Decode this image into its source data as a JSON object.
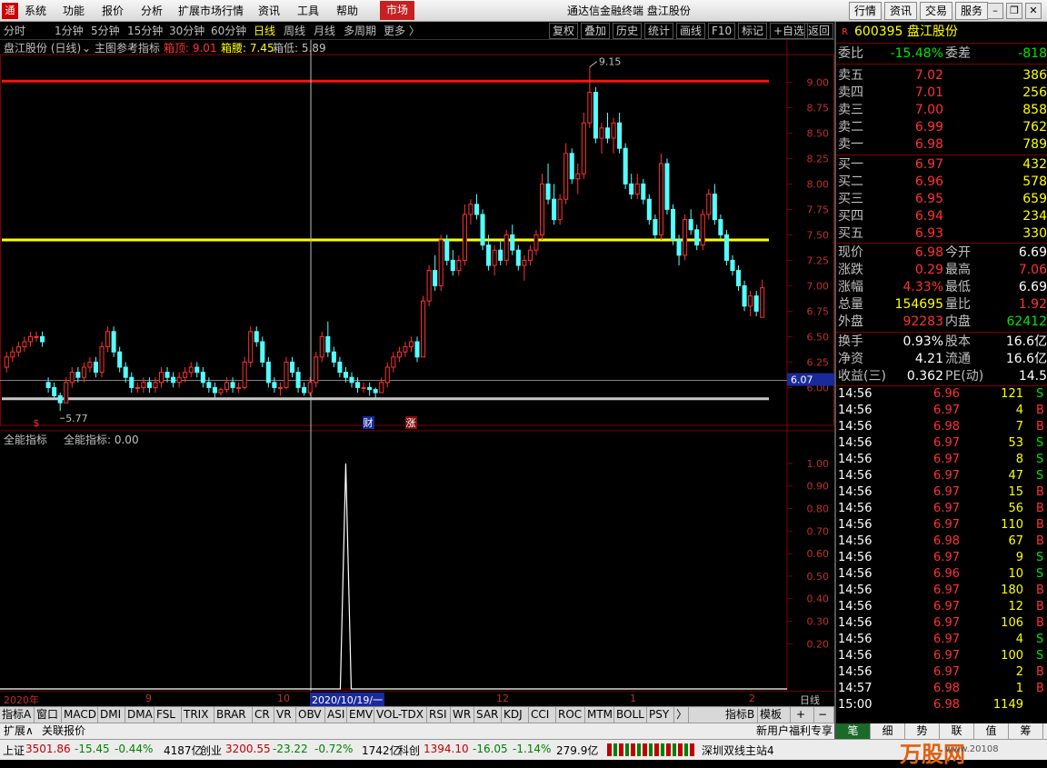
{
  "menubar": {
    "items": [
      "系统",
      "功能",
      "报价",
      "分析",
      "扩展市场行情",
      "资讯",
      "工具",
      "帮助"
    ],
    "market_button": "市场",
    "window_title": "通达信金融终端  盘江股份",
    "right_buttons": [
      "行情",
      "资讯",
      "交易",
      "服务"
    ]
  },
  "periods": {
    "items": [
      "分时",
      "1分钟",
      "5分钟",
      "15分钟",
      "30分钟",
      "60分钟",
      "日线",
      "周线",
      "月线",
      "多周期",
      "更多 〉"
    ],
    "active": "日线",
    "tools": [
      "复权",
      "叠加",
      "历史",
      "统计",
      "画线",
      "F10",
      "标记",
      "+自选",
      "返回"
    ]
  },
  "main_chart": {
    "stock_label": "盘江股份 (日线)",
    "indicator": "主图参考指标",
    "box_top_label": "箱顶: 9.01",
    "box_mid_label": "箱腰: 7.45",
    "box_bottom_label": "箱低: 5.89",
    "max_label": "9.15",
    "min_label": "5.77",
    "y_ticks": [
      "9.00",
      "8.75",
      "8.50",
      "8.25",
      "8.00",
      "7.75",
      "7.50",
      "7.25",
      "7.00",
      "6.75",
      "6.50",
      "6.25",
      "6.00"
    ],
    "current_price_tag": "6.07",
    "markers": [
      "$",
      "财",
      "涨"
    ]
  },
  "sub_chart": {
    "label": "全能指标",
    "value_label": "全能指标: 0.00",
    "y_ticks": [
      "1.00",
      "0.90",
      "0.80",
      "0.70",
      "0.60",
      "0.50",
      "0.40",
      "0.30",
      "0.20"
    ]
  },
  "x_axis": {
    "labels": [
      "2020年",
      "9",
      "10",
      "2020/10/19/一",
      "12",
      "1",
      "2"
    ],
    "right_label": "日线"
  },
  "indicators": {
    "items": [
      "指标A",
      "窗口",
      "MACD",
      "DMI",
      "DMA",
      "FSL",
      "TRIX",
      "BRAR",
      "CR",
      "VR",
      "OBV",
      "ASI",
      "EMV",
      "VOL-TDX",
      "RSI",
      "WR",
      "SAR",
      "KDJ",
      "CCI",
      "ROC",
      "MTM",
      "BOLL",
      "PSY",
      "〉"
    ],
    "right": [
      "指标B",
      "模板",
      "+",
      "−"
    ]
  },
  "ext_bar": {
    "items": [
      "扩展∧",
      "关联报价"
    ],
    "right": "新用户福利专享"
  },
  "statusbar": {
    "sh": {
      "name": "上证",
      "value": "3501.86",
      "chg": "-15.45",
      "pct": "-0.44%",
      "amt": "4187亿"
    },
    "cy": {
      "name": "创业",
      "value": "3200.55",
      "chg": "-23.22",
      "pct": "-0.72%",
      "amt": "1742亿"
    },
    "kc": {
      "name": "科创",
      "value": "1394.10",
      "chg": "-16.05",
      "pct": "-1.14%",
      "amt": "279.9亿"
    },
    "server": "深圳双线主站4",
    "watermark": "万股网",
    "watermark_url": "www.20108"
  },
  "quote": {
    "code": "600395",
    "name": "盘江股份",
    "badge": "R",
    "wb_label": "委比",
    "wb": "-15.48%",
    "wc_label": "委差",
    "wc": "-818",
    "asks": [
      {
        "label": "卖五",
        "price": "7.02",
        "vol": "386"
      },
      {
        "label": "卖四",
        "price": "7.01",
        "vol": "256"
      },
      {
        "label": "卖三",
        "price": "7.00",
        "vol": "858"
      },
      {
        "label": "卖二",
        "price": "6.99",
        "vol": "762"
      },
      {
        "label": "卖一",
        "price": "6.98",
        "vol": "789"
      }
    ],
    "bids": [
      {
        "label": "买一",
        "price": "6.97",
        "vol": "432"
      },
      {
        "label": "买二",
        "price": "6.96",
        "vol": "578"
      },
      {
        "label": "买三",
        "price": "6.95",
        "vol": "659"
      },
      {
        "label": "买四",
        "price": "6.94",
        "vol": "234"
      },
      {
        "label": "买五",
        "price": "6.93",
        "vol": "330"
      }
    ],
    "stats": [
      {
        "l1": "现价",
        "v1": "6.98",
        "c1": "red",
        "l2": "今开",
        "v2": "6.69",
        "c2": "white"
      },
      {
        "l1": "涨跌",
        "v1": "0.29",
        "c1": "red",
        "l2": "最高",
        "v2": "7.06",
        "c2": "red"
      },
      {
        "l1": "涨幅",
        "v1": "4.33%",
        "c1": "red",
        "l2": "最低",
        "v2": "6.69",
        "c2": "white"
      },
      {
        "l1": "总量",
        "v1": "154695",
        "c1": "yellow",
        "l2": "量比",
        "v2": "1.92",
        "c2": "red"
      },
      {
        "l1": "外盘",
        "v1": "92283",
        "c1": "red",
        "l2": "内盘",
        "v2": "62412",
        "c2": "green"
      }
    ],
    "stats2": [
      {
        "l1": "换手",
        "v1": "0.93%",
        "l2": "股本",
        "v2": "16.6亿"
      },
      {
        "l1": "净资",
        "v1": "4.21",
        "l2": "流通",
        "v2": "16.6亿"
      },
      {
        "l1": "收益(三)",
        "v1": "0.362",
        "l2": "PE(动)",
        "v2": "14.5"
      }
    ],
    "ticks": [
      {
        "t": "14:56",
        "p": "6.96",
        "q": "121",
        "s": "S"
      },
      {
        "t": "14:56",
        "p": "6.97",
        "q": "4",
        "s": "B"
      },
      {
        "t": "14:56",
        "p": "6.98",
        "q": "7",
        "s": "B"
      },
      {
        "t": "14:56",
        "p": "6.97",
        "q": "53",
        "s": "S"
      },
      {
        "t": "14:56",
        "p": "6.97",
        "q": "8",
        "s": "S"
      },
      {
        "t": "14:56",
        "p": "6.97",
        "q": "47",
        "s": "S"
      },
      {
        "t": "14:56",
        "p": "6.97",
        "q": "15",
        "s": "B"
      },
      {
        "t": "14:56",
        "p": "6.97",
        "q": "56",
        "s": "B"
      },
      {
        "t": "14:56",
        "p": "6.97",
        "q": "110",
        "s": "B"
      },
      {
        "t": "14:56",
        "p": "6.98",
        "q": "67",
        "s": "B"
      },
      {
        "t": "14:56",
        "p": "6.97",
        "q": "9",
        "s": "S"
      },
      {
        "t": "14:56",
        "p": "6.96",
        "q": "10",
        "s": "S"
      },
      {
        "t": "14:56",
        "p": "6.97",
        "q": "180",
        "s": "B"
      },
      {
        "t": "14:56",
        "p": "6.97",
        "q": "12",
        "s": "B"
      },
      {
        "t": "14:56",
        "p": "6.97",
        "q": "106",
        "s": "B"
      },
      {
        "t": "14:56",
        "p": "6.97",
        "q": "4",
        "s": "S"
      },
      {
        "t": "14:56",
        "p": "6.97",
        "q": "100",
        "s": "S"
      },
      {
        "t": "14:56",
        "p": "6.97",
        "q": "2",
        "s": "B"
      },
      {
        "t": "14:57",
        "p": "6.98",
        "q": "1",
        "s": "B"
      },
      {
        "t": "15:00",
        "p": "6.98",
        "q": "1149",
        "s": ""
      }
    ],
    "bottom_tabs": [
      "笔",
      "细",
      "势",
      "联",
      "值",
      "筹"
    ]
  },
  "chart_data": {
    "type": "candlestick",
    "y_ticks": [
      9.0,
      8.75,
      8.5,
      8.25,
      8.0,
      7.75,
      7.5,
      7.25,
      7.0,
      6.75,
      6.5,
      6.25,
      6.0
    ],
    "ylim": [
      5.7,
      9.2
    ],
    "box_top": 9.01,
    "box_mid": 7.45,
    "box_bottom": 5.89,
    "candles": [
      [
        6.2,
        6.35,
        6.15,
        6.3
      ],
      [
        6.3,
        6.4,
        6.25,
        6.35
      ],
      [
        6.35,
        6.45,
        6.3,
        6.4
      ],
      [
        6.4,
        6.5,
        6.35,
        6.45
      ],
      [
        6.45,
        6.55,
        6.4,
        6.5
      ],
      [
        6.5,
        6.55,
        6.45,
        6.5
      ],
      [
        6.5,
        6.55,
        6.4,
        6.45
      ],
      [
        6.05,
        6.1,
        5.95,
        6.0
      ],
      [
        6.0,
        6.05,
        5.9,
        5.92
      ],
      [
        5.92,
        5.95,
        5.77,
        5.85
      ],
      [
        5.85,
        6.1,
        5.85,
        6.05
      ],
      [
        6.05,
        6.2,
        6.0,
        6.15
      ],
      [
        6.15,
        6.2,
        6.05,
        6.1
      ],
      [
        6.1,
        6.25,
        6.05,
        6.2
      ],
      [
        6.2,
        6.3,
        6.15,
        6.25
      ],
      [
        6.25,
        6.3,
        6.1,
        6.15
      ],
      [
        6.15,
        6.45,
        6.1,
        6.4
      ],
      [
        6.4,
        6.6,
        6.35,
        6.55
      ],
      [
        6.55,
        6.6,
        6.3,
        6.35
      ],
      [
        6.35,
        6.4,
        6.15,
        6.2
      ],
      [
        6.2,
        6.25,
        6.05,
        6.1
      ],
      [
        6.1,
        6.15,
        5.95,
        6.0
      ],
      [
        6.0,
        6.05,
        5.95,
        6.0
      ],
      [
        6.0,
        6.1,
        5.95,
        6.05
      ],
      [
        6.05,
        6.1,
        5.95,
        6.0
      ],
      [
        6.0,
        6.1,
        5.95,
        6.05
      ],
      [
        6.05,
        6.2,
        6.0,
        6.15
      ],
      [
        6.15,
        6.2,
        6.05,
        6.1
      ],
      [
        6.1,
        6.15,
        6.0,
        6.05
      ],
      [
        6.05,
        6.15,
        6.0,
        6.1
      ],
      [
        6.1,
        6.2,
        6.05,
        6.15
      ],
      [
        6.15,
        6.25,
        6.1,
        6.2
      ],
      [
        6.2,
        6.25,
        6.1,
        6.15
      ],
      [
        6.15,
        6.2,
        6.0,
        6.05
      ],
      [
        6.05,
        6.1,
        5.95,
        6.0
      ],
      [
        6.0,
        6.05,
        5.9,
        5.95
      ],
      [
        5.95,
        6.0,
        5.92,
        5.98
      ],
      [
        5.98,
        6.1,
        5.95,
        6.05
      ],
      [
        6.05,
        6.1,
        5.95,
        6.0
      ],
      [
        6.0,
        6.05,
        5.95,
        6.0
      ],
      [
        6.0,
        6.3,
        5.98,
        6.25
      ],
      [
        6.25,
        6.6,
        6.2,
        6.55
      ],
      [
        6.55,
        6.6,
        6.4,
        6.45
      ],
      [
        6.45,
        6.5,
        6.2,
        6.25
      ],
      [
        6.25,
        6.3,
        6.0,
        6.05
      ],
      [
        6.05,
        6.1,
        5.95,
        6.0
      ],
      [
        6.0,
        6.05,
        5.92,
        6.0
      ],
      [
        6.0,
        6.3,
        5.98,
        6.25
      ],
      [
        6.25,
        6.3,
        6.1,
        6.15
      ],
      [
        6.15,
        6.2,
        5.95,
        6.0
      ],
      [
        6.0,
        6.05,
        5.92,
        5.95
      ],
      [
        5.95,
        6.1,
        5.92,
        6.05
      ],
      [
        6.05,
        6.35,
        6.0,
        6.3
      ],
      [
        6.3,
        6.55,
        6.25,
        6.5
      ],
      [
        6.5,
        6.65,
        6.3,
        6.35
      ],
      [
        6.35,
        6.4,
        6.2,
        6.25
      ],
      [
        6.25,
        6.3,
        6.1,
        6.15
      ],
      [
        6.15,
        6.2,
        6.05,
        6.1
      ],
      [
        6.1,
        6.15,
        6.0,
        6.05
      ],
      [
        6.05,
        6.1,
        5.95,
        6.0
      ],
      [
        6.0,
        6.05,
        5.95,
        6.0
      ],
      [
        6.0,
        6.05,
        5.92,
        5.98
      ],
      [
        5.98,
        6.0,
        5.9,
        5.95
      ],
      [
        5.95,
        6.1,
        5.95,
        6.05
      ],
      [
        6.05,
        6.25,
        6.0,
        6.2
      ],
      [
        6.2,
        6.35,
        6.15,
        6.3
      ],
      [
        6.3,
        6.4,
        6.25,
        6.35
      ],
      [
        6.35,
        6.45,
        6.3,
        6.4
      ],
      [
        6.4,
        6.5,
        6.35,
        6.45
      ],
      [
        6.45,
        6.5,
        6.25,
        6.3
      ],
      [
        6.3,
        6.9,
        6.3,
        6.85
      ],
      [
        6.85,
        7.2,
        6.8,
        7.15
      ],
      [
        7.15,
        7.3,
        6.95,
        7.0
      ],
      [
        7.0,
        7.5,
        6.95,
        7.45
      ],
      [
        7.45,
        7.5,
        7.2,
        7.25
      ],
      [
        7.25,
        7.35,
        7.1,
        7.15
      ],
      [
        7.15,
        7.3,
        7.1,
        7.25
      ],
      [
        7.25,
        7.8,
        7.2,
        7.7
      ],
      [
        7.7,
        7.85,
        7.6,
        7.8
      ],
      [
        7.8,
        7.9,
        7.65,
        7.7
      ],
      [
        7.7,
        7.75,
        7.35,
        7.4
      ],
      [
        7.4,
        7.5,
        7.15,
        7.2
      ],
      [
        7.2,
        7.4,
        7.1,
        7.35
      ],
      [
        7.35,
        7.45,
        7.2,
        7.25
      ],
      [
        7.25,
        7.55,
        7.2,
        7.5
      ],
      [
        7.5,
        7.6,
        7.3,
        7.35
      ],
      [
        7.35,
        7.4,
        7.15,
        7.2
      ],
      [
        7.2,
        7.3,
        7.05,
        7.25
      ],
      [
        7.25,
        7.4,
        7.2,
        7.35
      ],
      [
        7.35,
        7.55,
        7.3,
        7.5
      ],
      [
        7.5,
        8.1,
        7.45,
        8.0
      ],
      [
        8.0,
        8.2,
        7.8,
        7.85
      ],
      [
        7.85,
        8.0,
        7.6,
        7.65
      ],
      [
        7.65,
        7.9,
        7.6,
        7.85
      ],
      [
        7.85,
        8.4,
        7.8,
        8.3
      ],
      [
        8.3,
        8.35,
        8.0,
        8.05
      ],
      [
        8.05,
        8.2,
        7.9,
        8.1
      ],
      [
        8.1,
        8.7,
        8.05,
        8.6
      ],
      [
        8.6,
        9.15,
        8.55,
        8.9
      ],
      [
        8.9,
        8.95,
        8.4,
        8.45
      ],
      [
        8.45,
        8.6,
        8.3,
        8.55
      ],
      [
        8.55,
        8.7,
        8.4,
        8.45
      ],
      [
        8.45,
        8.65,
        8.3,
        8.6
      ],
      [
        8.6,
        8.7,
        8.3,
        8.35
      ],
      [
        8.35,
        8.4,
        7.95,
        8.0
      ],
      [
        8.0,
        8.1,
        7.85,
        7.9
      ],
      [
        7.9,
        8.1,
        7.85,
        8.0
      ],
      [
        8.0,
        8.05,
        7.8,
        7.85
      ],
      [
        7.85,
        7.9,
        7.6,
        7.65
      ],
      [
        7.65,
        7.7,
        7.45,
        7.5
      ],
      [
        7.5,
        8.3,
        7.45,
        8.2
      ],
      [
        8.2,
        8.25,
        7.7,
        7.75
      ],
      [
        7.75,
        7.8,
        7.4,
        7.45
      ],
      [
        7.45,
        7.5,
        7.2,
        7.3
      ],
      [
        7.3,
        7.7,
        7.25,
        7.65
      ],
      [
        7.65,
        7.75,
        7.5,
        7.55
      ],
      [
        7.55,
        7.6,
        7.35,
        7.4
      ],
      [
        7.4,
        7.75,
        7.35,
        7.7
      ],
      [
        7.7,
        7.95,
        7.65,
        7.9
      ],
      [
        7.9,
        8.0,
        7.6,
        7.65
      ],
      [
        7.65,
        7.7,
        7.45,
        7.5
      ],
      [
        7.5,
        7.55,
        7.2,
        7.25
      ],
      [
        7.25,
        7.3,
        7.1,
        7.15
      ],
      [
        7.15,
        7.2,
        6.95,
        7.0
      ],
      [
        7.0,
        7.05,
        6.75,
        6.8
      ],
      [
        6.8,
        6.95,
        6.7,
        6.9
      ],
      [
        6.9,
        6.95,
        6.7,
        6.75
      ],
      [
        6.69,
        7.06,
        6.69,
        6.98
      ]
    ],
    "sub_indicator": {
      "name": "全能指标",
      "signal_value": 1.0,
      "signal_index": 57,
      "ylim": [
        0,
        1.08
      ]
    }
  }
}
